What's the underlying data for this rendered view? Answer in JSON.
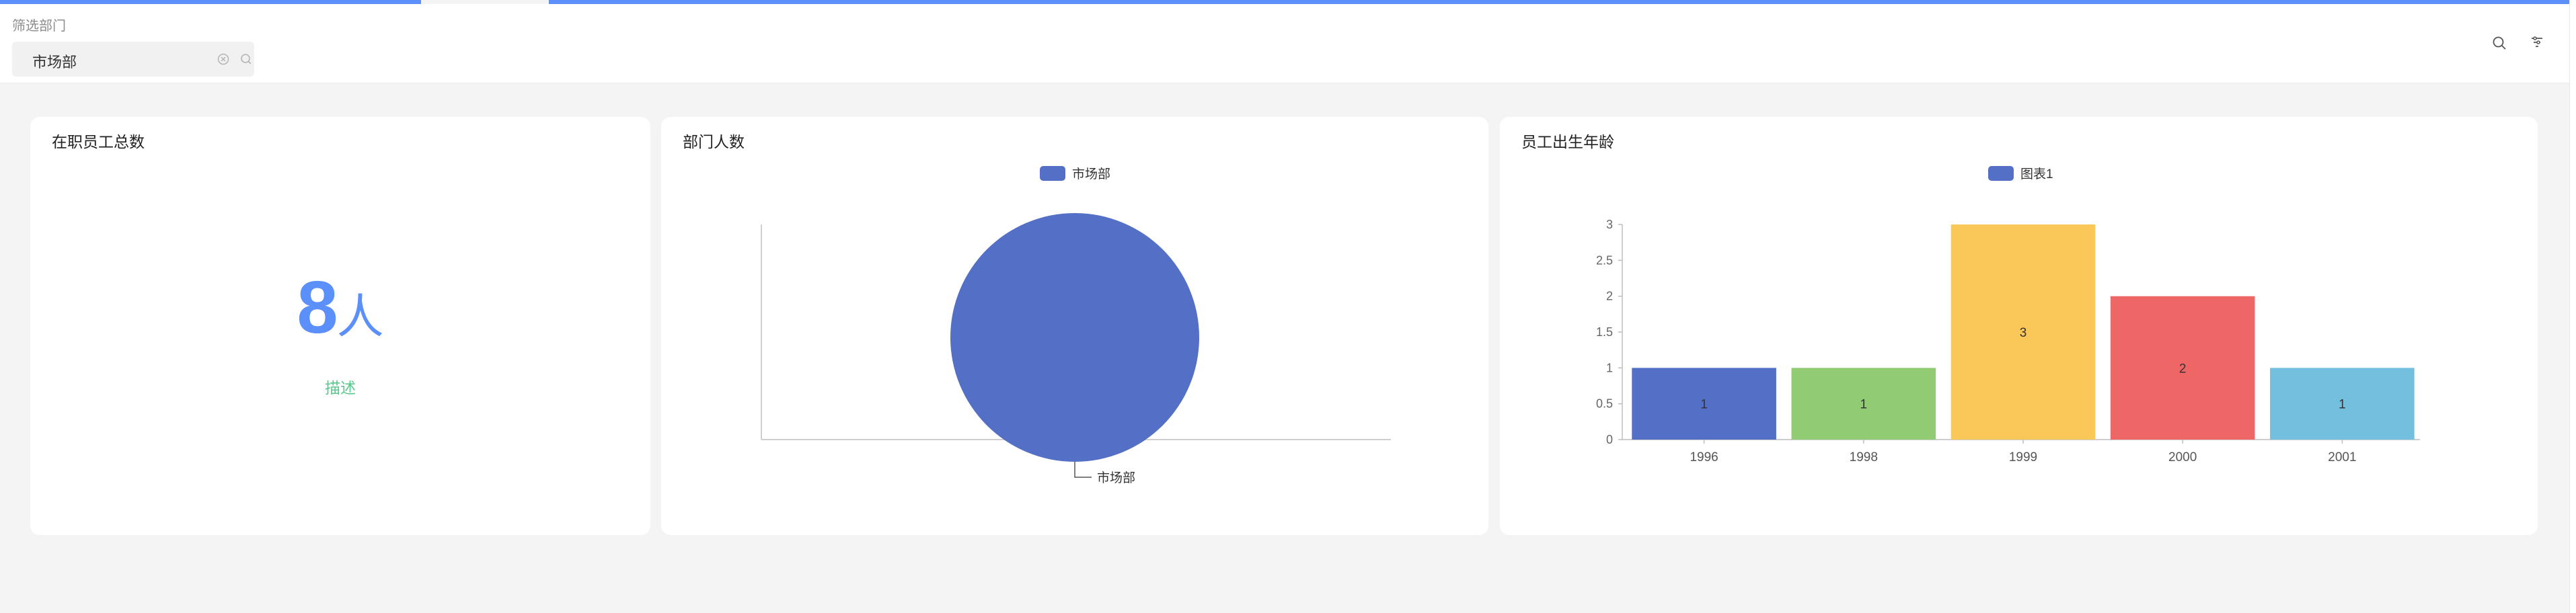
{
  "filter": {
    "label": "筛选部门",
    "selected": "市场部"
  },
  "cards": {
    "total": {
      "title": "在职员工总数",
      "value": "8",
      "unit": "人",
      "description": "描述",
      "value_color": "#5b8ff9",
      "description_color": "#5ac88d"
    },
    "dept": {
      "title": "部门人数",
      "legend": "市场部"
    },
    "age": {
      "title": "员工出生年龄",
      "legend": "图表1"
    }
  },
  "icons": {
    "clear": "close-circle-icon",
    "select_search": "search-icon",
    "toolbar_search": "search-icon",
    "toolbar_filter": "filter-icon"
  },
  "chart_data": [
    {
      "type": "pie",
      "title": "部门人数",
      "categories": [
        "市场部"
      ],
      "values": [
        1
      ],
      "colors": [
        "#5470c6"
      ],
      "slice_labels": [
        "市场部"
      ],
      "legend": "top-center"
    },
    {
      "type": "bar",
      "title": "员工出生年龄",
      "categories": [
        "1996",
        "1998",
        "1999",
        "2000",
        "2001"
      ],
      "series": [
        {
          "name": "图表1",
          "values": [
            1,
            1,
            3,
            2,
            1
          ]
        }
      ],
      "bar_colors": [
        "#5470c6",
        "#91cc75",
        "#fac858",
        "#ee6666",
        "#73c0de"
      ],
      "yticks": [
        "0",
        "0.5",
        "1",
        "1.5",
        "2",
        "2.5",
        "3"
      ],
      "ylim": [
        0,
        3
      ],
      "legend": "top-center",
      "grid": false
    }
  ]
}
